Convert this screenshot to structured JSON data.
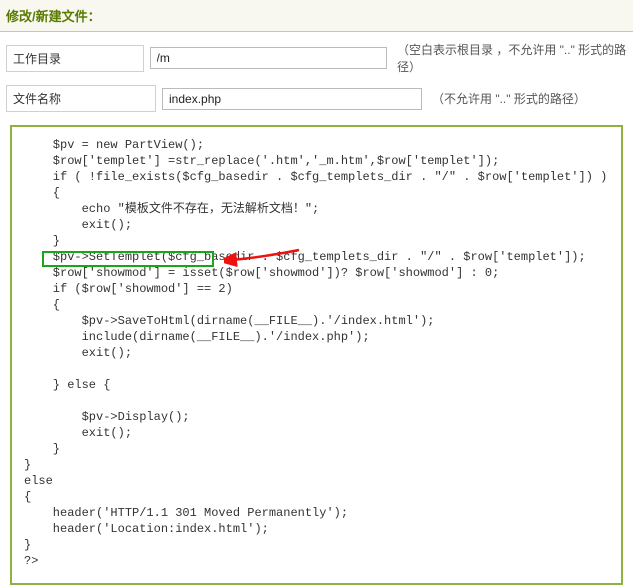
{
  "panel": {
    "title": "修改/新建文件："
  },
  "form": {
    "workdir_label": "工作目录",
    "workdir_value": "/m",
    "workdir_hint": "（空白表示根目录 ，不允许用 \"..\" 形式的路径）",
    "filename_label": "文件名称",
    "filename_value": "index.php",
    "filename_hint": "（不允许用 \"..\" 形式的路径）"
  },
  "code": {
    "content": "    $pv = new PartView();\n    $row['templet'] =str_replace('.htm','_m.htm',$row['templet']);\n    if ( !file_exists($cfg_basedir . $cfg_templets_dir . \"/\" . $row['templet']) )\n    {\n        echo \"模板文件不存在，无法解析文档！\";\n        exit();\n    }\n    $pv->SetTemplet($cfg_basedir . $cfg_templets_dir . \"/\" . $row['templet']);\n    $row['showmod'] = isset($row['showmod'])? $row['showmod'] : 0;\n    if ($row['showmod'] == 2)\n    {\n        $pv->SaveToHtml(dirname(__FILE__).'/index.html');\n        include(dirname(__FILE__).'/index.php');\n        exit();\n\n    } else {\n\n        $pv->Display();\n        exit();\n    }\n}\nelse\n{\n    header('HTTP/1.1 301 Moved Permanently');\n    header('Location:index.html');\n}\n?>"
  }
}
